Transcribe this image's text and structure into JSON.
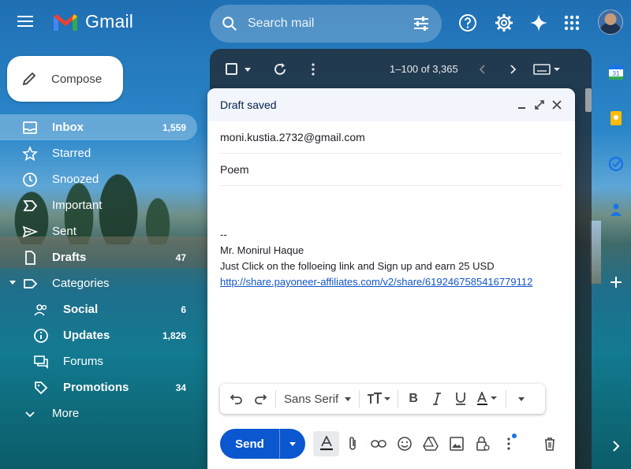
{
  "app": {
    "name": "Gmail",
    "search_placeholder": "Search mail"
  },
  "compose_button": {
    "label": "Compose"
  },
  "nav": {
    "items": [
      {
        "label": "Inbox",
        "count": "1,559",
        "icon": "inbox-icon"
      },
      {
        "label": "Starred",
        "count": "",
        "icon": "star-icon"
      },
      {
        "label": "Snoozed",
        "count": "",
        "icon": "clock-icon"
      },
      {
        "label": "Important",
        "count": "",
        "icon": "important-icon"
      },
      {
        "label": "Sent",
        "count": "",
        "icon": "send-icon"
      },
      {
        "label": "Drafts",
        "count": "47",
        "icon": "draft-icon"
      },
      {
        "label": "Categories",
        "count": "",
        "icon": "label-icon"
      },
      {
        "label": "Social",
        "count": "6",
        "icon": "people-icon"
      },
      {
        "label": "Updates",
        "count": "1,826",
        "icon": "info-icon"
      },
      {
        "label": "Forums",
        "count": "",
        "icon": "forum-icon"
      },
      {
        "label": "Promotions",
        "count": "34",
        "icon": "tag-icon"
      },
      {
        "label": "More",
        "count": "",
        "icon": "chevron-down-icon"
      }
    ]
  },
  "list": {
    "pager": "1–100 of 3,365"
  },
  "compose_window": {
    "title": "Draft saved",
    "to": "moni.kustia.2732@gmail.com",
    "subject": "Poem",
    "signature_sep": "--",
    "signature_name": "Mr. Monirul Haque",
    "body_line": "Just Click on the folloeing link and Sign up and earn 25 USD",
    "link": "http://share.payoneer-affiliates.com/v2/share/6192467585416779112",
    "font_name": "Sans Serif",
    "send_label": "Send"
  },
  "colors": {
    "accent": "#0b57d0",
    "link": "#1155cc",
    "header_bg": "#f2f6fc"
  }
}
